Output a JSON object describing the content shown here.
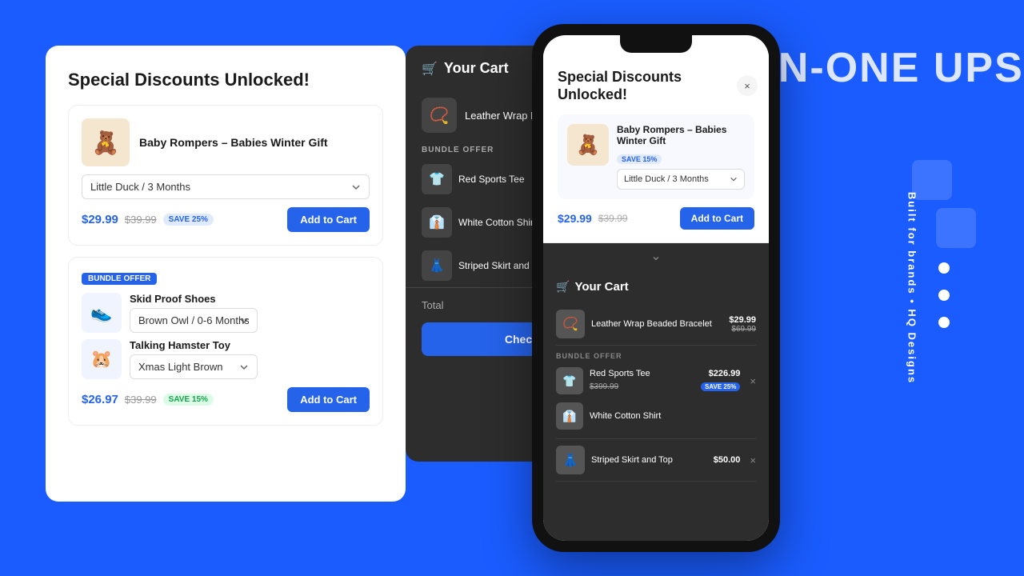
{
  "background": {
    "color": "#1a5cff",
    "headline": "ALL-IN-ONE UPSELL I"
  },
  "sidebar_right": {
    "vertical_text": "Built for brands • HQ Designs"
  },
  "desktop_panel": {
    "title": "Special Discounts Unlocked!",
    "product1": {
      "name": "Baby Rompers – Babies Winter Gift",
      "emoji": "🧸",
      "variant": "Little Duck / 3 Months",
      "price_new": "$29.99",
      "price_old": "$39.99",
      "save_badge": "SAVE 25%",
      "add_label": "Add to Cart"
    },
    "bundle_badge": "BUNDLE OFFER",
    "bundle_items": [
      {
        "name": "Skid Proof Shoes",
        "emoji": "👟",
        "variant": "Brown Owl / 0-6 Months"
      },
      {
        "name": "Talking Hamster Toy",
        "emoji": "🐹",
        "variant": "Xmas Light Brown"
      }
    ],
    "bundle_price_new": "$26.97",
    "bundle_price_old": "$39.99",
    "bundle_save": "SAVE 15%",
    "bundle_add_label": "Add to Cart"
  },
  "cart_panel": {
    "title": "Your Cart",
    "close": "×",
    "item1": {
      "name": "Leather Wrap Beaded Bracelet",
      "emoji": "📿"
    },
    "bundle_label": "BUNDLE OFFER",
    "bundle_item1": {
      "name": "Red Sports Tee",
      "emoji": "👕"
    },
    "bundle_item2": {
      "name": "White Cotton Shirt",
      "emoji": "👔"
    },
    "bundle_item3": {
      "name": "Striped Skirt and To...",
      "emoji": "👗"
    },
    "total_label": "Total",
    "checkout_label": "Checko..."
  },
  "mobile": {
    "discount_title": "Special Discounts Unlocked!",
    "close": "×",
    "product": {
      "name": "Baby Rompers – Babies Winter Gift",
      "save_badge": "SAVE 15%",
      "emoji": "🧸",
      "variant": "Little Duck / 3 Months",
      "price_new": "$29.99",
      "price_old": "$39.99",
      "add_label": "Add to Cart"
    },
    "cart": {
      "title": "Your Cart",
      "item1": {
        "name": "Leather Wrap Beaded Bracelet",
        "price": "$29.99",
        "price_old": "$69.99",
        "emoji": "📿"
      },
      "bundle_label": "BUNDLE OFFER",
      "bundle_item1": {
        "name": "Red Sports Tee",
        "price": "$226.99",
        "price_old": "$399.99",
        "save": "SAVE 25%",
        "emoji": "👕"
      },
      "bundle_item2": {
        "name": "White Cotton Shirt",
        "emoji": "👔"
      },
      "bundle_item3": {
        "name": "Striped Skirt and Top",
        "price": "$50.00",
        "emoji": "👗"
      }
    }
  }
}
